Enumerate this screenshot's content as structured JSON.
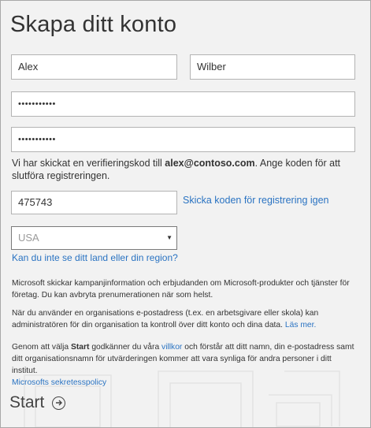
{
  "page": {
    "title": "Skapa ditt konto"
  },
  "form": {
    "first_name": "Alex",
    "last_name": "Wilber",
    "password": "•••••••••••",
    "confirm_password": "•••••••••••",
    "verify_prefix": "Vi har skickat en verifieringskod till ",
    "verify_email": "alex@contoso.com",
    "verify_suffix": ". Ange koden för att slutföra registreringen.",
    "code": "475743",
    "resend_label": "Skicka koden för registrering igen",
    "country": "USA",
    "country_missing_link": "Kan du inte se ditt land eller din region?"
  },
  "notices": {
    "marketing": "Microsoft skickar kampanjinformation och erbjudanden om Microsoft-produkter och tjänster för företag. Du kan avbryta prenumerationen när som helst.",
    "org_text": "När du använder en organisations e-postadress (t.ex. en arbetsgivare eller skola) kan administratören för din organisation ta kontroll över ditt konto och dina data. ",
    "org_link": "Läs mer.",
    "terms_prefix": "Genom att välja ",
    "terms_start_word": "Start",
    "terms_mid": " godkänner du våra ",
    "terms_link": "villkor",
    "terms_suffix": " och förstår att ditt namn, din e-postadress samt ditt organisationsnamn för utvärderingen kommer att vara synliga för andra personer i ditt institut.",
    "privacy_link": "Microsofts sekretesspolicy"
  },
  "footer": {
    "start_label": "Start",
    "start_icon": "arrow-circle-right-icon"
  },
  "colors": {
    "link": "#2a73c2",
    "background": "#f2f2f2",
    "border": "#b3b3b3"
  }
}
